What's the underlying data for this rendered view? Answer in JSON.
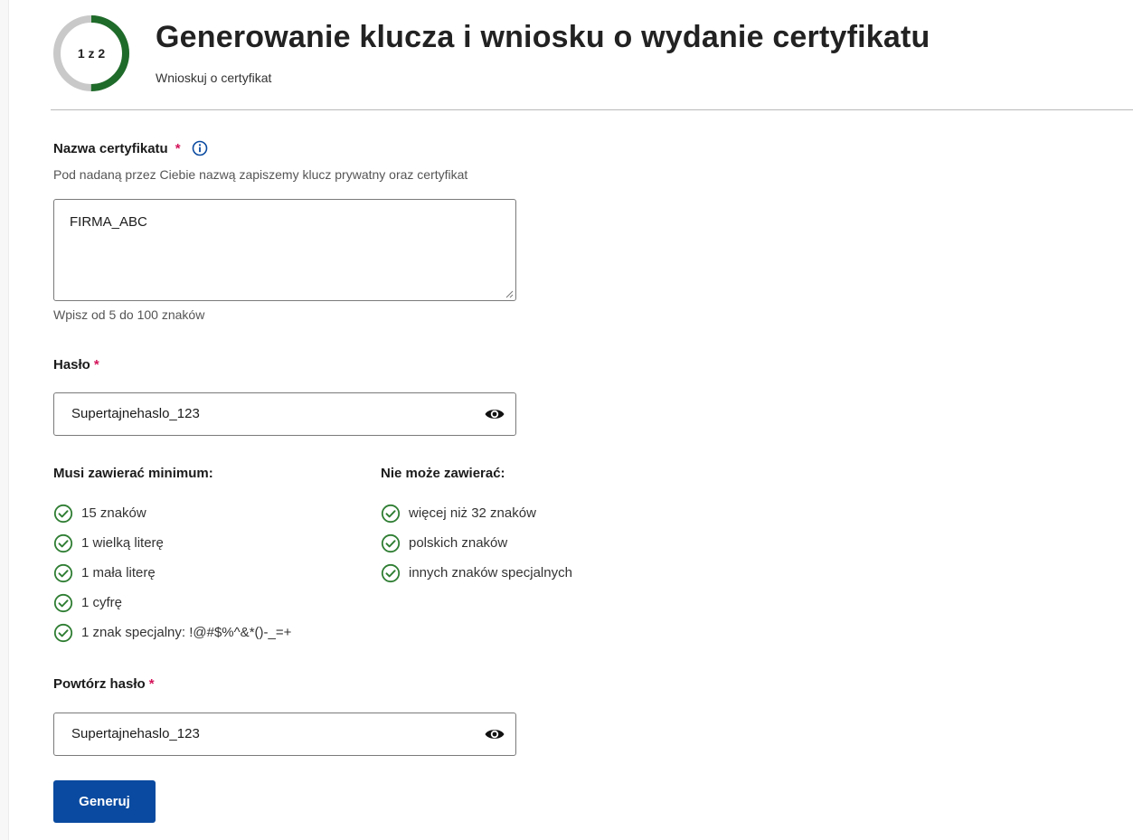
{
  "header": {
    "step_label": "1 z 2",
    "step_progress": 0.5,
    "title": "Generowanie klucza i wniosku o wydanie certyfikatu",
    "subtitle": "Wnioskuj o certyfikat"
  },
  "certificate_name": {
    "label": "Nazwa certyfikatu",
    "required_mark": "*",
    "info_icon": "info-icon",
    "description": "Pod nadaną przez Ciebie nazwą zapiszemy klucz prywatny oraz certyfikat",
    "value": "FIRMA_ABC",
    "hint": "Wpisz od 5 do 100 znaków"
  },
  "password": {
    "label": "Hasło",
    "required_mark": "*",
    "value": "Supertajnehaslo_123",
    "toggle_icon": "eye-icon"
  },
  "requirements": {
    "must_heading": "Musi zawierać minimum:",
    "must_items": [
      "15 znaków",
      "1 wielką literę",
      "1 mała literę",
      "1 cyfrę",
      "1 znak specjalny: !@#$%^&*()-_=+"
    ],
    "cannot_heading": "Nie może zawierać:",
    "cannot_items": [
      "więcej niż 32 znaków",
      "polskich znaków",
      "innych znaków specjalnych"
    ],
    "check_icon": "check-circle-icon"
  },
  "password_repeat": {
    "label": "Powtórz hasło",
    "required_mark": "*",
    "value": "Supertajnehaslo_123",
    "toggle_icon": "eye-icon"
  },
  "actions": {
    "generate_label": "Generuj"
  },
  "colors": {
    "primary": "#0a4aa0",
    "progress": "#1f6b2a",
    "progress_track": "#c9c9c9",
    "required": "#d4145a",
    "check": "#2e7d32",
    "info": "#0a4aa0"
  }
}
